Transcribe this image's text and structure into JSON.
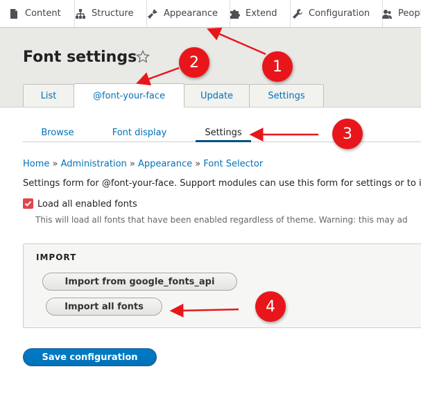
{
  "toolbar": {
    "items": [
      {
        "label": "Content",
        "icon": "content-page-icon"
      },
      {
        "label": "Structure",
        "icon": "structure-sitemap-icon"
      },
      {
        "label": "Appearance",
        "icon": "paintbrush-icon"
      },
      {
        "label": "Extend",
        "icon": "puzzle-icon"
      },
      {
        "label": "Configuration",
        "icon": "wrench-icon"
      },
      {
        "label": "People",
        "icon": "people-icon"
      }
    ]
  },
  "page": {
    "title": "Font settings"
  },
  "primary_tabs": [
    {
      "label": "List",
      "active": false
    },
    {
      "label": "@font-your-face",
      "active": true
    },
    {
      "label": "Update",
      "active": false
    },
    {
      "label": "Settings",
      "active": false
    }
  ],
  "secondary_tabs": [
    {
      "label": "Browse",
      "active": false
    },
    {
      "label": "Font display",
      "active": false
    },
    {
      "label": "Settings",
      "active": true
    }
  ],
  "breadcrumb": {
    "items": [
      "Home",
      "Administration",
      "Appearance",
      "Font Selector"
    ],
    "separator": "»"
  },
  "form": {
    "description": "Settings form for @font-your-face. Support modules can use this form for settings or to i",
    "load_all_checkbox": {
      "label": "Load all enabled fonts",
      "checked": true,
      "description": "This will load all fonts that have been enabled regardless of theme. Warning: this may ad"
    },
    "import_section": {
      "legend": "IMPORT",
      "buttons": [
        "Import from google_fonts_api",
        "Import all fonts"
      ]
    },
    "save_button": "Save configuration"
  },
  "annotations": {
    "badges": [
      "1",
      "2",
      "3",
      "4"
    ],
    "color": "#e8161a"
  },
  "colors": {
    "link": "#0071b8",
    "primary_button": "#0071b8",
    "checkbox": "#e2474b",
    "header_bg": "#e9e9e6"
  }
}
